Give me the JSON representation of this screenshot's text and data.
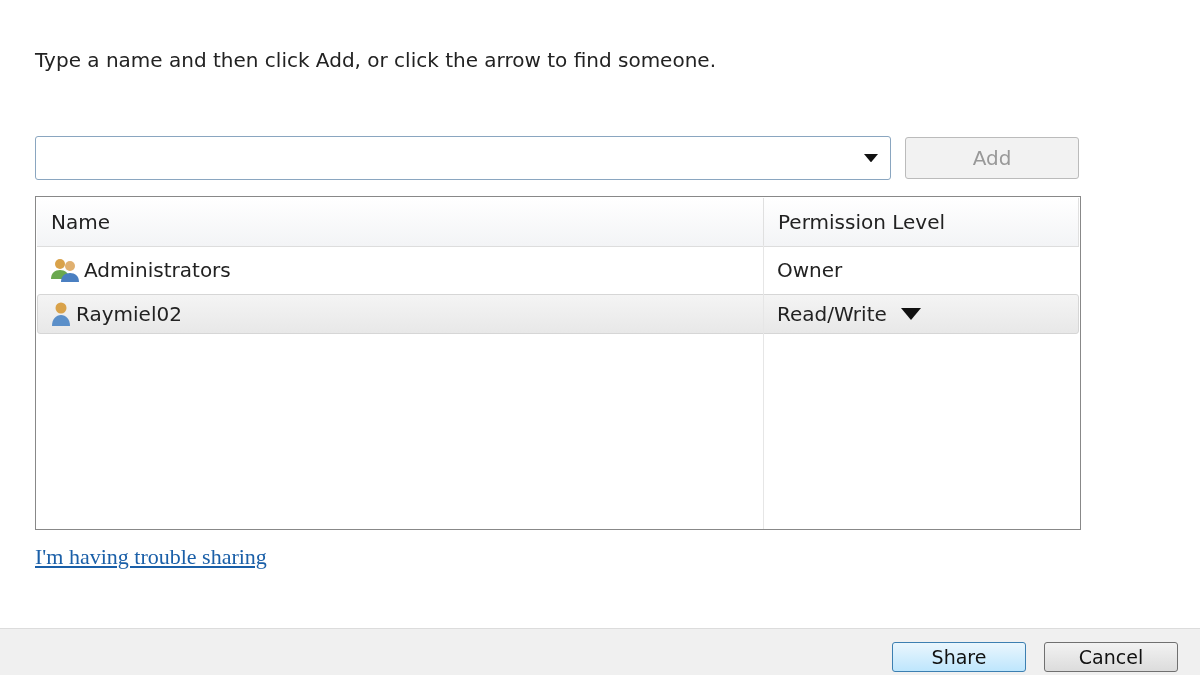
{
  "instruction": "Type a name and then click Add, or click the arrow to find someone.",
  "name_field": {
    "disabled_add": true,
    "add_label": "Add"
  },
  "table": {
    "columns": [
      "Name",
      "Permission Level"
    ],
    "rows": [
      {
        "kind": "group",
        "name": "Administrators",
        "permission": "Owner",
        "selected": false,
        "has_dropdown": false
      },
      {
        "kind": "user",
        "name": "Raymiel02",
        "permission": "Read/Write",
        "selected": true,
        "has_dropdown": true
      }
    ]
  },
  "help_link": "I'm having trouble sharing",
  "buttons": [
    {
      "label": "Share",
      "default": true
    },
    {
      "label": "Cancel",
      "default": false
    }
  ]
}
